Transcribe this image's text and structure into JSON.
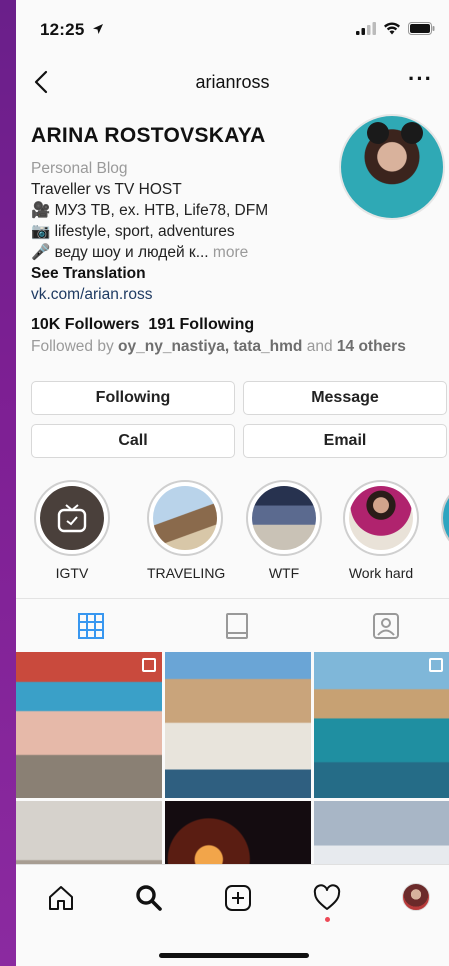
{
  "status_bar": {
    "time": "12:25"
  },
  "header": {
    "username": "arianross",
    "more": "···"
  },
  "profile": {
    "name": "ARINA ROSTOVSKAYA",
    "category": "Personal Blog",
    "bio_lines": [
      "Traveller vs TV HOST",
      "🎥 МУЗ ТВ, ex. НТВ, Life78, DFM",
      "📷 lifestyle, sport, adventures",
      "🎤 веду шоу и людей к..."
    ],
    "more": "more",
    "see_translation": "See Translation",
    "link": "vk.com/arian.ross",
    "followers": "10K Followers",
    "following": "191 Following",
    "followed_by_prefix": "Followed by",
    "followed_by_users": "oy_ny_nastiya, tata_hmd",
    "followed_by_and": "and",
    "followed_by_others": "14 others"
  },
  "buttons": {
    "following": "Following",
    "message": "Message",
    "call": "Call",
    "email": "Email"
  },
  "highlights": [
    {
      "label": "IGTV"
    },
    {
      "label": "TRAVELING"
    },
    {
      "label": "WTF"
    },
    {
      "label": "Work hard"
    }
  ],
  "tabs": [
    "grid-icon",
    "feed-icon",
    "tagged-icon"
  ],
  "bottom_nav": [
    "home-icon",
    "search-icon",
    "add-icon",
    "heart-icon",
    "profile-avatar"
  ],
  "colors": {
    "accent_blue": "#3897f0",
    "link": "#1f3b63",
    "muted": "#9a9a9a",
    "notification_dot": "#ed4956"
  }
}
